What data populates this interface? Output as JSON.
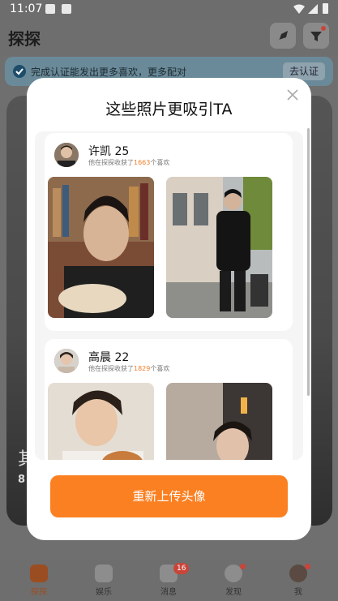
{
  "status_bar": {
    "time": "11:07"
  },
  "app": {
    "title": "探探"
  },
  "banner": {
    "text": "完成认证能发出更多喜欢，更多配对",
    "button": "去认证"
  },
  "background_card": {
    "partial_text_1": "其",
    "partial_text_2": "8"
  },
  "modal": {
    "title": "这些照片更吸引TA",
    "users": [
      {
        "name": "许凯",
        "age": "25",
        "subtitle_prefix": "他在探探收获了",
        "like_count": "1663",
        "subtitle_suffix": "个喜欢"
      },
      {
        "name": "高晨",
        "age": "22",
        "subtitle_prefix": "他在探探收获了",
        "like_count": "1829",
        "subtitle_suffix": "个喜欢"
      }
    ],
    "upload_button": "重新上传头像"
  },
  "bottom_nav": {
    "items": [
      {
        "label": "探探",
        "icon": "tantan-icon",
        "active": true
      },
      {
        "label": "娱乐",
        "icon": "tv-icon"
      },
      {
        "label": "消息",
        "icon": "chat-icon",
        "badge": "16"
      },
      {
        "label": "发现",
        "icon": "compass-icon",
        "dot": true
      },
      {
        "label": "我",
        "icon": "avatar-icon",
        "dot": true
      }
    ]
  },
  "colors": {
    "accent": "#fb8022",
    "badge": "#e84f3f",
    "overlay": "#6e6e6e"
  }
}
